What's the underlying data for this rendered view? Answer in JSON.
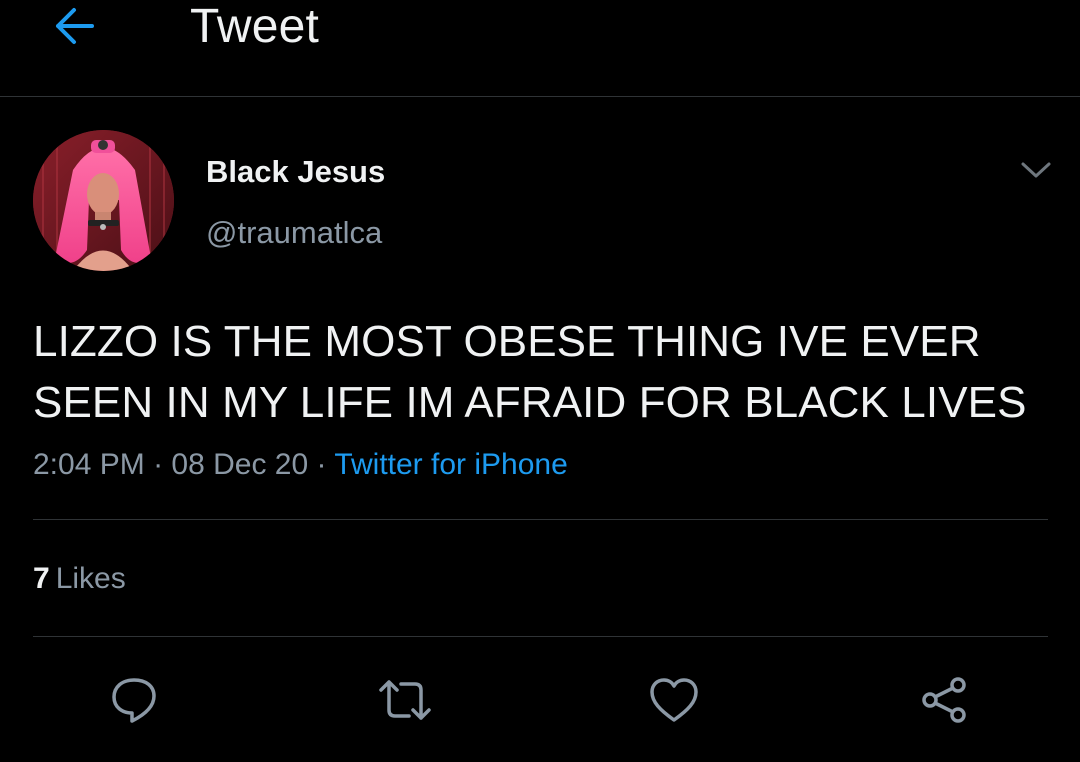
{
  "header": {
    "title": "Tweet",
    "back_icon": "arrow-left-icon",
    "accent_color": "#1d9bf0"
  },
  "tweet": {
    "author_name": "Black Jesus",
    "author_handle": "@traumatlca",
    "avatar_icon": "avatar",
    "more_icon": "chevron-down-icon",
    "text_line_1": "LIZZO IS THE MOST OBESE THING IVE EVER",
    "text_line_2": "SEEN IN MY LIFE IM AFRAID FOR BLACK LIVES",
    "time": "2:04 PM",
    "separator": "·",
    "date": "08 Dec 20",
    "source": "Twitter for iPhone"
  },
  "stats": {
    "likes_count": "7",
    "likes_label": "Likes"
  },
  "actions": {
    "reply_icon": "reply-icon",
    "retweet_icon": "retweet-icon",
    "like_icon": "heart-icon",
    "share_icon": "share-icon"
  },
  "colors": {
    "background": "#000000",
    "primary_text": "#f0f2f3",
    "secondary_text": "#8b98a5",
    "link": "#1d9bf0",
    "divider": "#2f3336"
  }
}
